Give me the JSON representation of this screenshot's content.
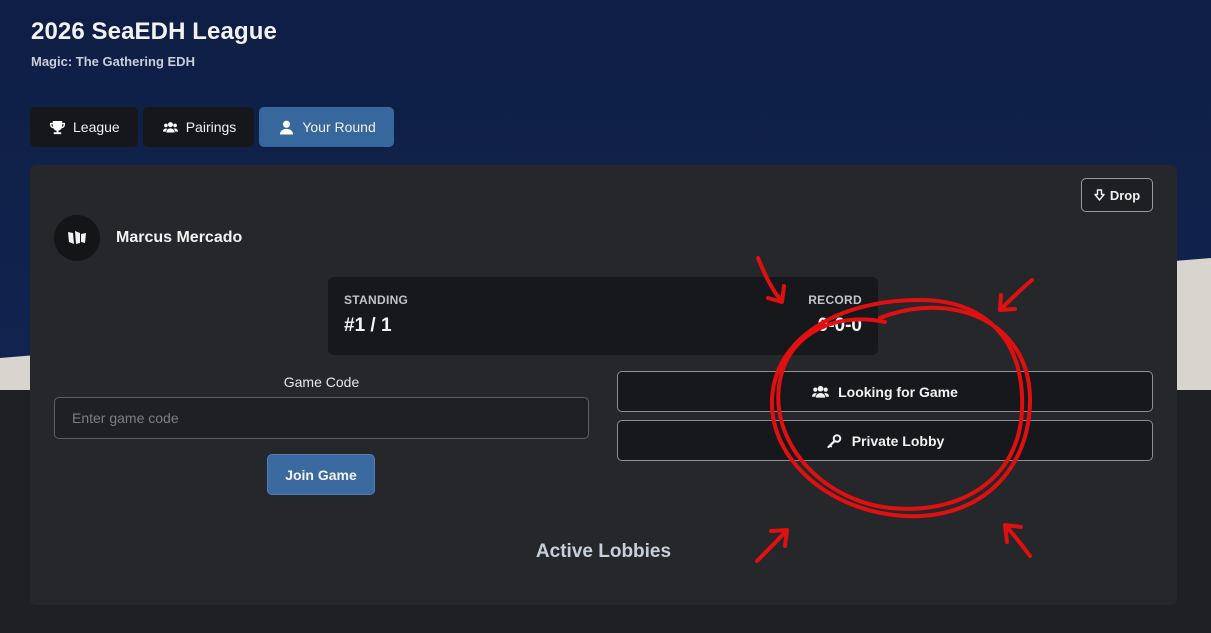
{
  "header": {
    "title": "2026 SeaEDH League",
    "subtitle": "Magic: The Gathering EDH"
  },
  "tabs": [
    {
      "label": "League",
      "icon": "trophy-icon",
      "active": false
    },
    {
      "label": "Pairings",
      "icon": "users-icon",
      "active": false
    },
    {
      "label": "Your Round",
      "icon": "user-icon",
      "active": true
    }
  ],
  "card": {
    "drop_label": "Drop",
    "player": {
      "name": "Marcus Mercado",
      "avatar_icon": "mtg-logo-icon"
    },
    "stats": {
      "standing_label": "STANDING",
      "standing_value": "#1 / 1",
      "record_label": "RECORD",
      "record_value": "0-0-0"
    },
    "game_code": {
      "label": "Game Code",
      "placeholder": "Enter game code",
      "value": "",
      "join_label": "Join Game"
    },
    "actions": {
      "looking_for_game": "Looking for Game",
      "private_lobby": "Private Lobby"
    },
    "active_lobbies_title": "Active Lobbies"
  },
  "colors": {
    "header_bg": "#0f1f45",
    "card_bg": "#25272a",
    "accent": "#37679c",
    "annotation": "#e01010"
  }
}
